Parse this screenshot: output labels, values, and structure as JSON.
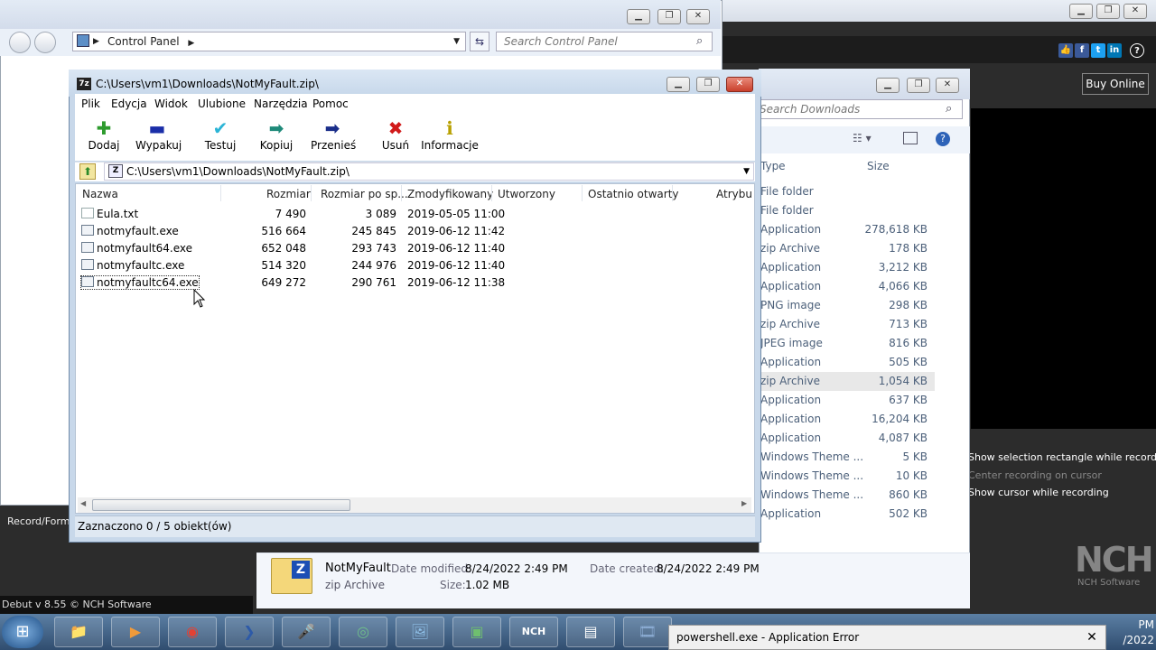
{
  "debut": {
    "buy_online": "Buy Online",
    "options": [
      "Show selection rectangle while recording",
      "Center recording on cursor",
      "Show cursor while recording"
    ],
    "record_format": "Record/Forma",
    "footer": "Debut v 8.55 © NCH Software",
    "logo": "NCH",
    "logo_sub": "NCH Software",
    "social": [
      "thumbs-up-icon",
      "facebook-icon",
      "twitter-icon",
      "linkedin-icon",
      "help-icon"
    ]
  },
  "control_panel": {
    "address": "Control Panel",
    "search_placeholder": "Search Control Panel"
  },
  "downloads": {
    "search_placeholder": "Search Downloads",
    "col_type": "Type",
    "col_size": "Size",
    "rows": [
      {
        "type": "File folder",
        "size": ""
      },
      {
        "type": "File folder",
        "size": ""
      },
      {
        "type": "Application",
        "size": "278,618 KB"
      },
      {
        "type": "zip Archive",
        "size": "178 KB"
      },
      {
        "type": "Application",
        "size": "3,212 KB"
      },
      {
        "type": "Application",
        "size": "4,066 KB"
      },
      {
        "type": "PNG image",
        "size": "298 KB"
      },
      {
        "type": "zip Archive",
        "size": "713 KB"
      },
      {
        "type": "JPEG image",
        "size": "816 KB"
      },
      {
        "type": "Application",
        "size": "505 KB"
      },
      {
        "type": "zip Archive",
        "size": "1,054 KB"
      },
      {
        "type": "Application",
        "size": "637 KB"
      },
      {
        "type": "Application",
        "size": "16,204 KB"
      },
      {
        "type": "Application",
        "size": "4,087 KB"
      },
      {
        "type": "Windows Theme ...",
        "size": "5 KB"
      },
      {
        "type": "Windows Theme ...",
        "size": "10 KB"
      },
      {
        "type": "Windows Theme ...",
        "size": "860 KB"
      },
      {
        "type": "Application",
        "size": "502 KB"
      }
    ],
    "details": {
      "name": "NotMyFault",
      "type": "zip Archive",
      "modified_label": "Date modified:",
      "modified": "8/24/2022 2:49 PM",
      "created_label": "Date created:",
      "created": "8/24/2022 2:49 PM",
      "size_label": "Size:",
      "size": "1.02 MB"
    }
  },
  "sevenzip": {
    "title": "C:\\Users\\vm1\\Downloads\\NotMyFault.zip\\",
    "menu": [
      "Plik",
      "Edycja",
      "Widok",
      "Ulubione",
      "Narzędzia",
      "Pomoc"
    ],
    "toolbar": [
      {
        "label": "Dodaj",
        "icon": "add-icon",
        "glyph": "✚",
        "color": "#2e9b2e"
      },
      {
        "label": "Wypakuj",
        "icon": "extract-icon",
        "glyph": "▬",
        "color": "#1a2ea8"
      },
      {
        "label": "Testuj",
        "icon": "test-icon",
        "glyph": "✔",
        "color": "#2bb4d6"
      },
      {
        "label": "Kopiuj",
        "icon": "copy-icon",
        "glyph": "➡",
        "color": "#1f8a7a"
      },
      {
        "label": "Przenieś",
        "icon": "move-icon",
        "glyph": "➡",
        "color": "#1a2e8a"
      },
      {
        "label": "Usuń",
        "icon": "delete-icon",
        "glyph": "✖",
        "color": "#d11a1a"
      },
      {
        "label": "Informacje",
        "icon": "info-icon",
        "glyph": "ℹ",
        "color": "#b8a000"
      }
    ],
    "path": "C:\\Users\\vm1\\Downloads\\NotMyFault.zip\\",
    "columns": [
      "Nazwa",
      "Rozmiar",
      "Rozmiar po sp...",
      "Zmodyfikowany",
      "Utworzony",
      "Ostatnio otwarty",
      "Atrybut"
    ],
    "files": [
      {
        "name": "Eula.txt",
        "size": "7 490",
        "packed": "3 089",
        "modified": "2019-05-05 11:00",
        "kind": "txt"
      },
      {
        "name": "notmyfault.exe",
        "size": "516 664",
        "packed": "245 845",
        "modified": "2019-06-12 11:42",
        "kind": "exe"
      },
      {
        "name": "notmyfault64.exe",
        "size": "652 048",
        "packed": "293 743",
        "modified": "2019-06-12 11:40",
        "kind": "exe"
      },
      {
        "name": "notmyfaultc.exe",
        "size": "514 320",
        "packed": "244 976",
        "modified": "2019-06-12 11:40",
        "kind": "exe"
      },
      {
        "name": "notmyfaultc64.exe",
        "size": "649 272",
        "packed": "290 761",
        "modified": "2019-06-12 11:38",
        "kind": "exe"
      }
    ],
    "status": "Zaznaczono 0 / 5 obiekt(ów)"
  },
  "taskbar": {
    "error_window": "powershell.exe - Application Error",
    "clock_time": "PM",
    "clock_date": "/2022",
    "items": [
      "explorer-icon",
      "media-player-icon",
      "chrome-icon",
      "powershell-icon",
      "microphone-icon",
      "network-icon",
      "photo-viewer-icon",
      "monitor-icon",
      "nch-icon",
      "document-icon",
      "film-icon"
    ]
  }
}
